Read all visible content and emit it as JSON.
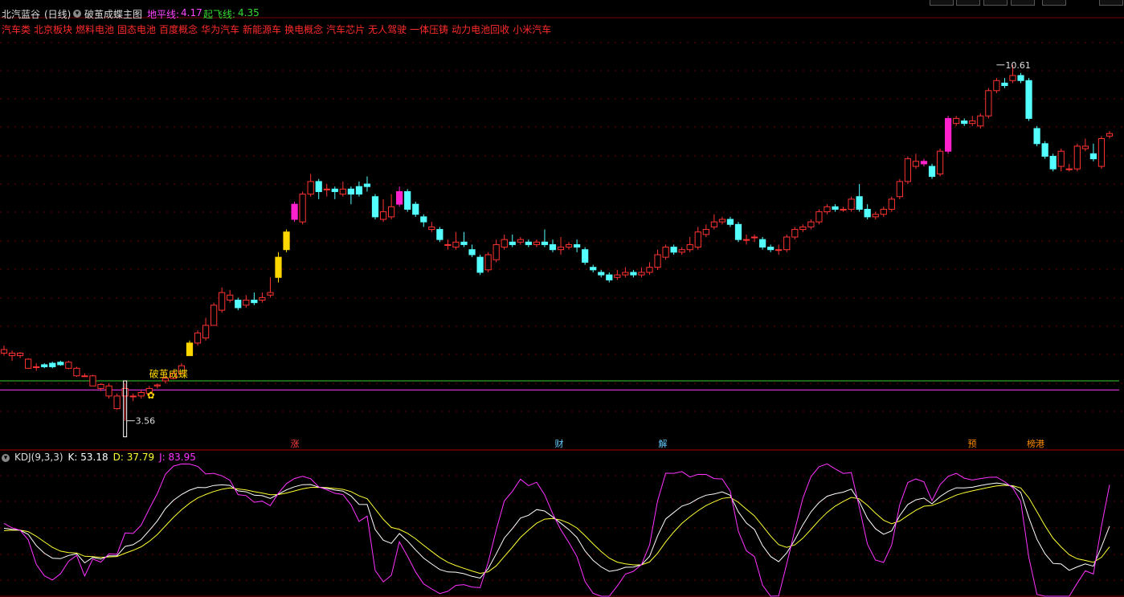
{
  "header": {
    "stock_name": "北汽蓝谷",
    "period": "(日线)",
    "indicator_name": "破茧成蝶主图",
    "ground_line_label": "地平线:",
    "ground_line_value": "4.17",
    "takeoff_line_label": "起飞线:",
    "takeoff_line_value": "4.35"
  },
  "concepts": [
    "汽车类",
    "北京板块",
    "燃料电池",
    "固态电池",
    "百度概念",
    "华为汽车",
    "新能源车",
    "换电概念",
    "汽车芯片",
    "无人驾驶",
    "一体压铸",
    "动力电池回收",
    "小米汽车"
  ],
  "annotations": {
    "signal_text": "破茧成蝶",
    "high_label": "10.61",
    "low_label": "3.56"
  },
  "event_markers": [
    {
      "text": "涨",
      "color": "#ff4040"
    },
    {
      "text": "财",
      "color": "#66ccff"
    },
    {
      "text": "解",
      "color": "#66ccff"
    },
    {
      "text": "预",
      "color": "#ff8c00"
    },
    {
      "text": "榜港",
      "color": "#ff8c00"
    }
  ],
  "kdj": {
    "label": "KDJ(9,3,3)",
    "k_label": "K: 53.18",
    "d_label": "D: 37.79",
    "j_label": "J: 83.95"
  },
  "colors": {
    "up": "#ff3333",
    "down": "#54ffff",
    "signal_yellow": "#ffd700",
    "signal_magenta": "#ff22cc",
    "ground_line": "#cc33cc",
    "takeoff_line": "#33cc33",
    "k_line": "#ffffff",
    "d_line": "#ffff33",
    "j_line": "#ff33ff"
  },
  "chart_data": {
    "type": "candlestick",
    "price_range": [
      3.3,
      11.1
    ],
    "ground_line": 4.17,
    "takeoff_line": 4.35,
    "high_marker": 10.61,
    "low_marker": 3.56,
    "candles": [
      [
        4.9,
        4.97,
        5.05,
        4.85
      ],
      [
        4.85,
        4.9,
        4.95,
        4.75
      ],
      [
        4.85,
        4.9,
        4.92,
        4.8
      ],
      [
        4.6,
        4.78,
        4.8,
        4.6
      ],
      [
        4.63,
        4.63,
        4.7,
        4.55
      ],
      [
        4.67,
        4.63,
        4.7,
        4.6
      ],
      [
        4.7,
        4.63,
        4.73,
        4.6
      ],
      [
        4.72,
        4.67,
        4.75,
        4.65
      ],
      [
        4.6,
        4.72,
        4.75,
        4.58
      ],
      [
        4.45,
        4.6,
        4.63,
        4.43
      ],
      [
        4.45,
        4.45,
        4.5,
        4.43
      ],
      [
        4.25,
        4.45,
        4.47,
        4.25
      ],
      [
        4.2,
        4.28,
        4.3,
        4.15
      ],
      [
        4.05,
        4.25,
        4.3,
        4.0
      ],
      [
        3.8,
        4.05,
        4.1,
        3.78
      ],
      [
        4.05,
        4.2,
        4.3,
        3.56
      ],
      [
        4.05,
        4.05,
        4.1,
        3.95
      ],
      [
        4.05,
        4.12,
        4.18,
        4.0
      ],
      [
        4.1,
        4.2,
        4.25,
        4.05
      ],
      [
        4.25,
        4.27,
        4.3,
        4.2
      ],
      [
        4.35,
        4.4,
        4.45,
        4.3
      ],
      [
        4.4,
        4.5,
        4.55,
        4.38
      ],
      [
        4.5,
        4.65,
        4.7,
        4.48
      ],
      [
        4.85,
        5.1,
        5.15,
        4.85
      ],
      [
        5.1,
        5.3,
        5.35,
        5.05
      ],
      [
        5.2,
        5.45,
        5.6,
        5.15
      ],
      [
        5.45,
        5.85,
        5.9,
        5.45
      ],
      [
        5.75,
        6.1,
        6.2,
        5.7
      ],
      [
        5.95,
        6.05,
        6.15,
        5.9
      ],
      [
        5.95,
        5.8,
        6.0,
        5.75
      ],
      [
        5.85,
        5.95,
        6.05,
        5.8
      ],
      [
        5.95,
        5.9,
        6.1,
        5.85
      ],
      [
        5.95,
        6.0,
        6.1,
        5.9
      ],
      [
        6.05,
        6.1,
        6.4,
        6.0
      ],
      [
        6.4,
        6.8,
        6.9,
        6.3
      ],
      [
        6.95,
        7.3,
        7.35,
        6.9
      ],
      [
        7.55,
        7.85,
        7.9,
        7.5
      ],
      [
        7.5,
        8.05,
        8.1,
        7.45
      ],
      [
        8.05,
        8.3,
        8.45,
        8.0
      ],
      [
        8.3,
        8.1,
        8.35,
        7.95
      ],
      [
        8.15,
        8.15,
        8.25,
        8.0
      ],
      [
        8.15,
        8.1,
        8.2,
        7.95
      ],
      [
        8.05,
        8.15,
        8.3,
        8.0
      ],
      [
        8.15,
        8.05,
        8.2,
        7.85
      ],
      [
        8.2,
        8.05,
        8.3,
        8.0
      ],
      [
        8.25,
        8.2,
        8.4,
        8.1
      ],
      [
        8.0,
        7.6,
        8.05,
        7.55
      ],
      [
        7.55,
        7.7,
        7.95,
        7.5
      ],
      [
        7.6,
        7.8,
        8.05,
        7.55
      ],
      [
        7.85,
        8.1,
        8.2,
        7.8
      ],
      [
        8.1,
        7.75,
        8.15,
        7.7
      ],
      [
        7.85,
        7.65,
        7.9,
        7.6
      ],
      [
        7.6,
        7.5,
        7.65,
        7.4
      ],
      [
        7.35,
        7.4,
        7.5,
        7.3
      ],
      [
        7.35,
        7.15,
        7.4,
        7.1
      ],
      [
        7.05,
        7.05,
        7.15,
        6.95
      ],
      [
        7.0,
        7.1,
        7.3,
        6.95
      ],
      [
        7.1,
        7.05,
        7.3,
        7.0
      ],
      [
        6.95,
        6.85,
        7.05,
        6.8
      ],
      [
        6.8,
        6.5,
        6.85,
        6.45
      ],
      [
        6.55,
        6.85,
        6.9,
        6.5
      ],
      [
        6.75,
        7.05,
        7.15,
        6.7
      ],
      [
        7.0,
        7.15,
        7.25,
        6.95
      ],
      [
        7.1,
        7.05,
        7.25,
        7.0
      ],
      [
        7.1,
        7.15,
        7.2,
        7.05
      ],
      [
        7.1,
        7.05,
        7.15,
        7.0
      ],
      [
        7.05,
        7.1,
        7.15,
        7.0
      ],
      [
        7.1,
        7.05,
        7.35,
        7.0
      ],
      [
        7.05,
        6.95,
        7.15,
        6.9
      ],
      [
        6.95,
        7.0,
        7.2,
        6.85
      ],
      [
        7.0,
        7.05,
        7.1,
        6.95
      ],
      [
        7.05,
        7.0,
        7.15,
        6.9
      ],
      [
        6.95,
        6.7,
        7.0,
        6.65
      ],
      [
        6.6,
        6.55,
        6.65,
        6.5
      ],
      [
        6.5,
        6.45,
        6.55,
        6.4
      ],
      [
        6.45,
        6.35,
        6.5,
        6.3
      ],
      [
        6.4,
        6.45,
        6.55,
        6.35
      ],
      [
        6.45,
        6.5,
        6.6,
        6.4
      ],
      [
        6.5,
        6.45,
        6.55,
        6.4
      ],
      [
        6.45,
        6.5,
        6.6,
        6.4
      ],
      [
        6.5,
        6.6,
        6.7,
        6.45
      ],
      [
        6.6,
        6.85,
        6.95,
        6.55
      ],
      [
        6.8,
        7.0,
        7.05,
        6.75
      ],
      [
        7.0,
        6.9,
        7.05,
        6.85
      ],
      [
        6.9,
        6.95,
        7.0,
        6.85
      ],
      [
        6.95,
        7.05,
        7.2,
        6.9
      ],
      [
        7.0,
        7.3,
        7.4,
        6.95
      ],
      [
        7.25,
        7.35,
        7.45,
        7.2
      ],
      [
        7.4,
        7.5,
        7.65,
        7.35
      ],
      [
        7.5,
        7.55,
        7.6,
        7.45
      ],
      [
        7.55,
        7.45,
        7.6,
        7.4
      ],
      [
        7.45,
        7.15,
        7.5,
        7.1
      ],
      [
        7.15,
        7.15,
        7.25,
        7.05
      ],
      [
        7.2,
        7.2,
        7.25,
        7.1
      ],
      [
        7.15,
        7.0,
        7.2,
        6.95
      ],
      [
        7.0,
        6.95,
        7.05,
        6.9
      ],
      [
        6.95,
        6.95,
        7.05,
        6.85
      ],
      [
        6.95,
        7.2,
        7.25,
        6.9
      ],
      [
        7.2,
        7.35,
        7.4,
        7.15
      ],
      [
        7.35,
        7.4,
        7.45,
        7.3
      ],
      [
        7.4,
        7.5,
        7.55,
        7.35
      ],
      [
        7.5,
        7.7,
        7.75,
        7.45
      ],
      [
        7.7,
        7.8,
        7.85,
        7.65
      ],
      [
        7.8,
        7.75,
        7.85,
        7.7
      ],
      [
        7.75,
        7.75,
        7.8,
        7.7
      ],
      [
        7.75,
        7.95,
        8.0,
        7.7
      ],
      [
        8.0,
        7.75,
        8.25,
        7.7
      ],
      [
        7.75,
        7.6,
        7.85,
        7.55
      ],
      [
        7.6,
        7.65,
        7.7,
        7.55
      ],
      [
        7.65,
        7.75,
        7.8,
        7.6
      ],
      [
        7.75,
        7.95,
        8.0,
        7.7
      ],
      [
        8.0,
        8.3,
        8.35,
        7.95
      ],
      [
        8.3,
        8.75,
        8.8,
        8.25
      ],
      [
        8.6,
        8.7,
        8.85,
        8.55
      ],
      [
        8.7,
        8.65,
        8.75,
        8.6
      ],
      [
        8.6,
        8.4,
        8.65,
        8.35
      ],
      [
        8.45,
        8.9,
        8.95,
        8.4
      ],
      [
        8.9,
        9.55,
        9.6,
        8.85
      ],
      [
        9.45,
        9.55,
        9.6,
        9.4
      ],
      [
        9.5,
        9.45,
        9.55,
        9.4
      ],
      [
        9.45,
        9.5,
        9.6,
        9.4
      ],
      [
        9.4,
        9.6,
        9.65,
        9.35
      ],
      [
        9.6,
        10.1,
        10.15,
        9.55
      ],
      [
        10.1,
        10.3,
        10.35,
        10.05
      ],
      [
        10.25,
        10.2,
        10.35,
        10.15
      ],
      [
        10.3,
        10.4,
        10.61,
        10.25
      ],
      [
        10.4,
        10.3,
        10.45,
        10.25
      ],
      [
        10.3,
        9.55,
        10.35,
        9.5
      ],
      [
        9.35,
        9.05,
        9.4,
        9.0
      ],
      [
        9.05,
        8.8,
        9.1,
        8.75
      ],
      [
        8.8,
        8.55,
        8.85,
        8.5
      ],
      [
        8.6,
        8.9,
        8.95,
        8.5
      ],
      [
        8.55,
        8.55,
        8.65,
        8.5
      ],
      [
        8.55,
        9.0,
        9.05,
        8.5
      ],
      [
        8.95,
        9.0,
        9.15,
        8.9
      ],
      [
        8.85,
        8.75,
        9.05,
        8.7
      ],
      [
        8.6,
        9.15,
        9.2,
        8.55
      ],
      [
        9.2,
        9.25,
        9.3,
        9.15
      ]
    ]
  }
}
